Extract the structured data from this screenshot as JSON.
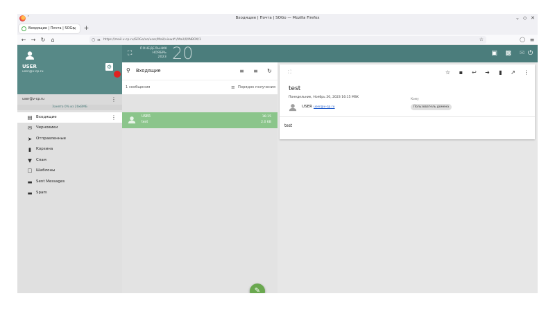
{
  "browser": {
    "window_title": "Входящие | Почта | SOGo — Mozilla Firefox",
    "tab_title": "Входящие | Почта | SOGo",
    "url": "https://mail.v-cp.ru/SOGo/so/user/Mail/view#!/Mail/0/INBOX/1"
  },
  "header": {
    "weekday": "ПОНЕДЕЛЬНИК",
    "month": "НОЯБРЬ",
    "year": "2023",
    "day": "20"
  },
  "user": {
    "name": "USER",
    "email": "user@v-cp.ru"
  },
  "account": {
    "email": "user@v-cp.ru",
    "quota": "Занято 0% из 20кВМБ"
  },
  "folders": [
    {
      "label": "Входящие",
      "icon": "inbox-icon"
    },
    {
      "label": "Черновики",
      "icon": "drafts-icon"
    },
    {
      "label": "Отправленные",
      "icon": "send-icon"
    },
    {
      "label": "Корзина",
      "icon": "trash-icon"
    },
    {
      "label": "Спам",
      "icon": "spam-icon"
    },
    {
      "label": "Шаблоны",
      "icon": "template-icon"
    },
    {
      "label": "Sent Messages",
      "icon": "folder-icon"
    },
    {
      "label": "Spam",
      "icon": "folder-icon"
    }
  ],
  "list": {
    "folder_title": "Входящие",
    "count": "1 сообщения",
    "sort_label": "Порядок получения",
    "message": {
      "from": "USER",
      "subject": "test",
      "time": "16:15",
      "size": "2.0 KB"
    }
  },
  "reader": {
    "subject": "test",
    "date": "Понедельник, Ноябрь 20, 2023 16:15 MSK",
    "from_name": "USER",
    "from_email": "user@v-cp.ru",
    "to_label": "Кому",
    "to_value": "Пользователь домена",
    "body": "test"
  },
  "colors": {
    "header": "#4b7d7c",
    "sidebar_top": "#578987",
    "selected_message": "#8bc58b",
    "fab": "#6aa84f",
    "notification_dot": "#e02020"
  }
}
